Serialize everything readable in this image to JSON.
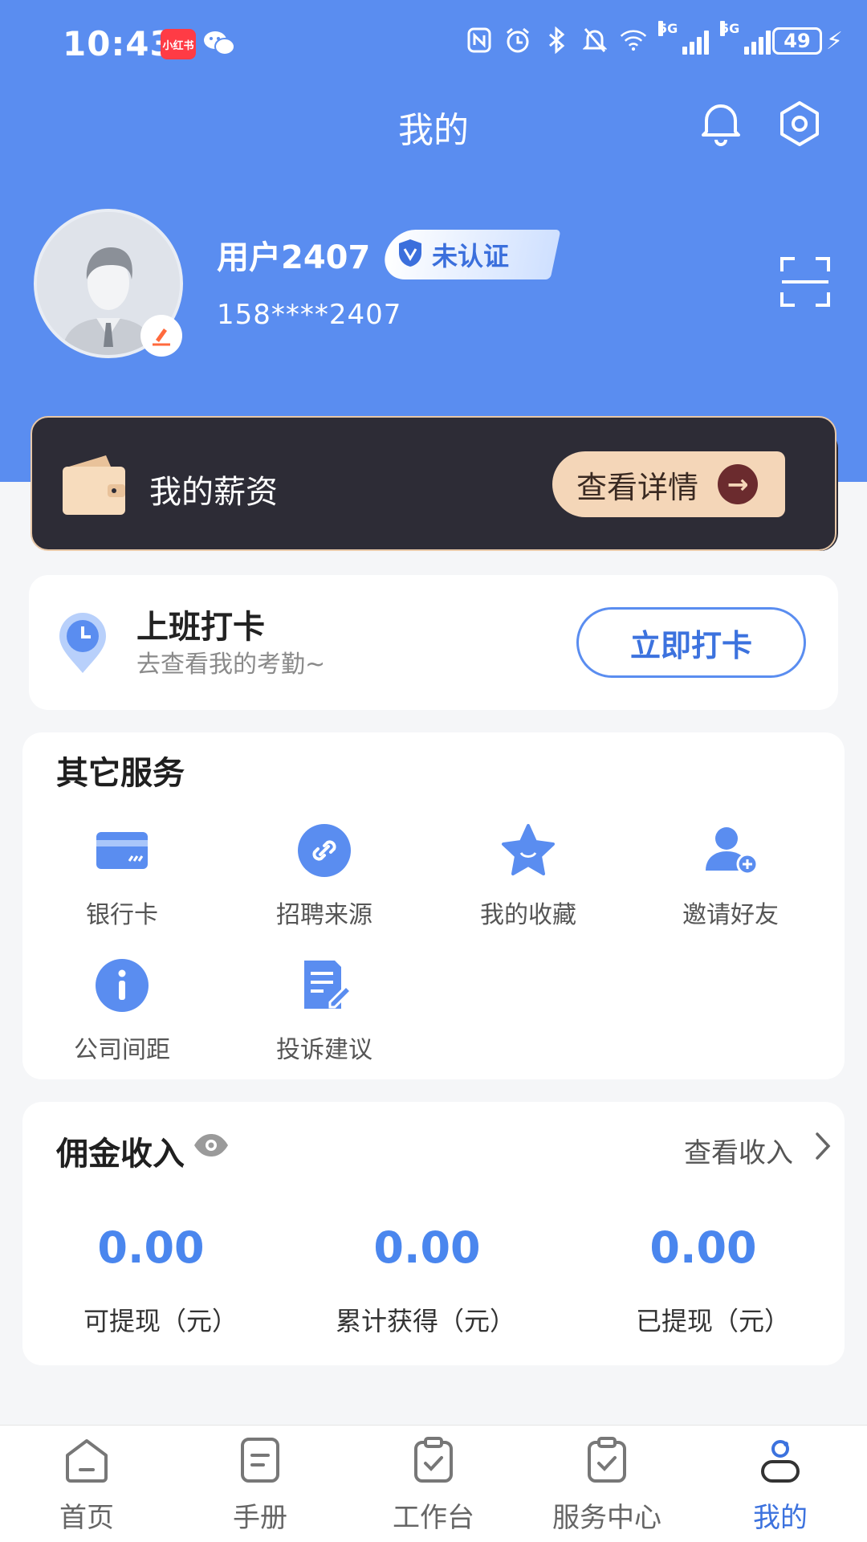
{
  "status_bar": {
    "time": "10:43",
    "app_badge": "小红书",
    "battery": "49",
    "network_a": "5G",
    "network_b": "5G"
  },
  "header": {
    "title": "我的"
  },
  "profile": {
    "username": "用户2407",
    "verify_status": "未认证",
    "phone": "158****2407"
  },
  "salary": {
    "title": "我的薪资",
    "detail_label": "查看详情"
  },
  "checkin": {
    "title": "上班打卡",
    "subtitle": "去查看我的考勤~",
    "button_label": "立即打卡"
  },
  "services": {
    "title": "其它服务",
    "items": [
      {
        "label": "银行卡",
        "icon": "bank-card-icon"
      },
      {
        "label": "招聘来源",
        "icon": "link-icon"
      },
      {
        "label": "我的收藏",
        "icon": "star-icon"
      },
      {
        "label": "邀请好友",
        "icon": "add-user-icon"
      },
      {
        "label": "公司间距",
        "icon": "info-icon"
      },
      {
        "label": "投诉建议",
        "icon": "edit-document-icon"
      }
    ]
  },
  "commission": {
    "title": "佣金收入",
    "view_label": "查看收入",
    "stats": [
      {
        "value": "0.00",
        "label": "可提现（元）"
      },
      {
        "value": "0.00",
        "label": "累计获得（元）"
      },
      {
        "value": "0.00",
        "label": "已提现（元）"
      }
    ]
  },
  "bottom_nav": {
    "items": [
      {
        "label": "首页",
        "icon": "home-icon"
      },
      {
        "label": "手册",
        "icon": "manual-icon"
      },
      {
        "label": "工作台",
        "icon": "workbench-icon"
      },
      {
        "label": "服务中心",
        "icon": "service-center-icon"
      },
      {
        "label": "我的",
        "icon": "profile-icon",
        "active": true
      }
    ]
  },
  "colors": {
    "primary": "#5a8df0",
    "accent_text": "#3c72de",
    "salary_card": "#2d2c36",
    "salary_button": "#f4d6b8"
  }
}
